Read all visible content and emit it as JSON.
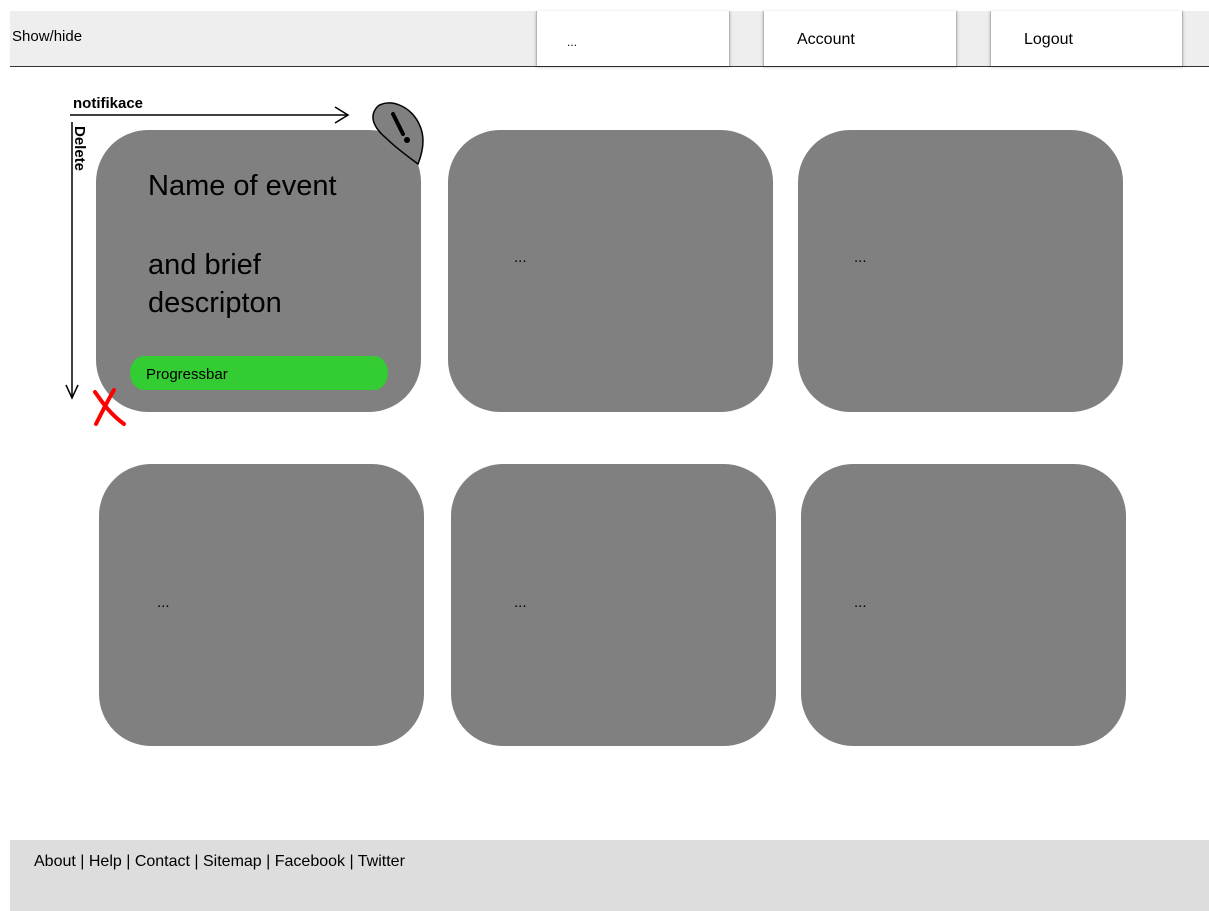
{
  "header": {
    "toggle_label": "Show/hide",
    "nav": [
      {
        "label": "..."
      },
      {
        "label": "Account"
      },
      {
        "label": "Logout"
      }
    ]
  },
  "annotations": {
    "notification_label": "notifikace",
    "delete_label": "Delete",
    "notification_icon": "bell-exclamation-icon",
    "delete_icon": "red-x-icon"
  },
  "cards": [
    {
      "title": "Name of event",
      "description": "and brief descripton",
      "progress_label": "Progressbar"
    },
    {
      "placeholder": "..."
    },
    {
      "placeholder": "..."
    },
    {
      "placeholder": "..."
    },
    {
      "placeholder": "..."
    },
    {
      "placeholder": "..."
    }
  ],
  "footer": {
    "links": [
      "About",
      "Help",
      "Contact",
      "Sitemap",
      "Facebook",
      "Twitter"
    ],
    "separator": " | "
  },
  "colors": {
    "card": "#808080",
    "progress": "#33cc33",
    "delete": "#ff0000",
    "header_bg": "#eeeeee",
    "footer_bg": "#dddddd"
  }
}
